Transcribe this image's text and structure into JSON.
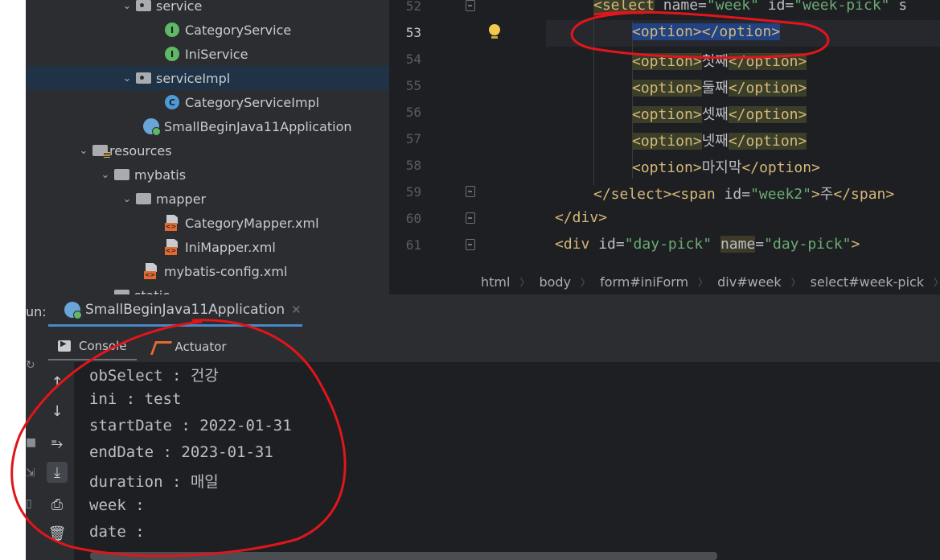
{
  "project_tree": {
    "items": [
      {
        "label": "service",
        "kind": "package",
        "expanded": true
      },
      {
        "label": "CategoryService",
        "kind": "interface"
      },
      {
        "label": "IniService",
        "kind": "interface"
      },
      {
        "label": "serviceImpl",
        "kind": "package",
        "expanded": true,
        "selected": true
      },
      {
        "label": "CategoryServiceImpl",
        "kind": "class"
      },
      {
        "label": "SmallBeginJava11Application",
        "kind": "spring-boot-app"
      },
      {
        "label": "resources",
        "kind": "resources-folder",
        "expanded": true
      },
      {
        "label": "mybatis",
        "kind": "folder",
        "expanded": true
      },
      {
        "label": "mapper",
        "kind": "folder",
        "expanded": true
      },
      {
        "label": "CategoryMapper.xml",
        "kind": "xml"
      },
      {
        "label": "IniMapper.xml",
        "kind": "xml"
      },
      {
        "label": "mybatis-config.xml",
        "kind": "xml"
      },
      {
        "label": "static",
        "kind": "folder"
      }
    ]
  },
  "editor": {
    "line_numbers": [
      "52",
      "53",
      "54",
      "55",
      "56",
      "57",
      "58",
      "59",
      "60",
      "61"
    ],
    "current_line": "53",
    "lines": {
      "l52": {
        "open": "<select",
        "name_attr": " name=",
        "name_val": "\"week\"",
        "id_attr": " id=",
        "id_val": "\"week-pick\"",
        "rest": " s"
      },
      "l53": {
        "text": "<option></option>"
      },
      "l54": {
        "open": "<option>",
        "content": "첫째",
        "close": "</option>"
      },
      "l55": {
        "open": "<option>",
        "content": "둘째",
        "close": "</option>"
      },
      "l56": {
        "open": "<option>",
        "content": "셋째",
        "close": "</option>"
      },
      "l57": {
        "open": "<option>",
        "content": "넷째",
        "close": "</option>"
      },
      "l58": {
        "open": "<option>",
        "content": "마지막",
        "close": "</option>"
      },
      "l59": {
        "close_select": "</select>",
        "span_open": "<span",
        "id_attr": " id=",
        "id_val": "\"week2\"",
        "gt": ">",
        "content": "주",
        "span_close": "</span>"
      },
      "l60": {
        "text": "</div>"
      },
      "l61": {
        "open": "<div",
        "id_attr": " id=",
        "id_val": "\"day-pick\"",
        "name_attr": "name",
        "name_eq": "=",
        "name_val": "\"day-pick\"",
        "gt": ">"
      }
    }
  },
  "breadcrumb": [
    "html",
    "body",
    "form#iniForm",
    "div#week",
    "select#week-pick"
  ],
  "run_panel": {
    "label": "un:",
    "tab_title": "SmallBeginJava11Application",
    "subtabs": [
      "Console",
      "Actuator"
    ],
    "console_lines": [
      "obSelect : 건강",
      "ini : test",
      "startDate : 2022-01-31",
      "endDate : 2023-01-31",
      "duration : 매일",
      "week :",
      "date :"
    ],
    "tool_icons": [
      "arrow-up-icon",
      "arrow-down-icon",
      "soft-wrap-icon",
      "scroll-to-end-icon",
      "print-icon",
      "trash-icon"
    ]
  },
  "colors": {
    "editor_bg": "#1e1f22",
    "panel_bg": "#2b2d30",
    "tag": "#d5b778",
    "string": "#6aab73",
    "selection": "#214283",
    "annotation": "#e0161b"
  }
}
